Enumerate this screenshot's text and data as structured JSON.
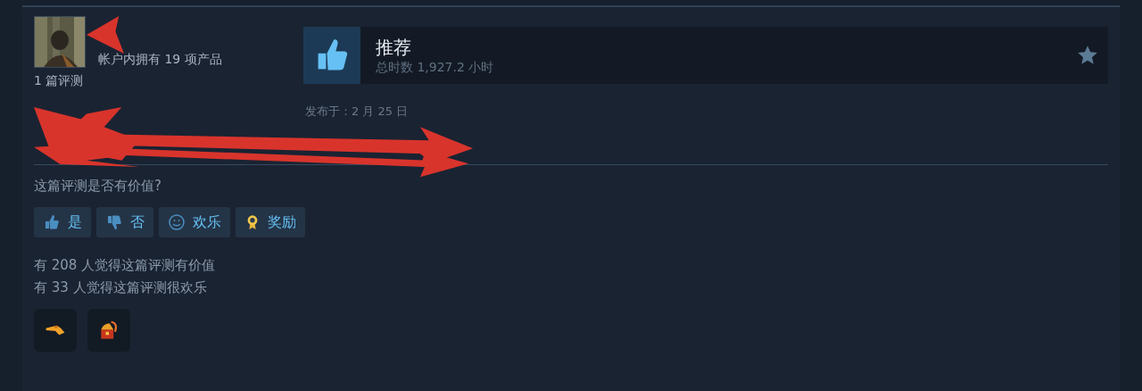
{
  "author": {
    "owned_products": "帐户内拥有 19 项产品",
    "review_count": "1 篇评测"
  },
  "verdict": {
    "title": "推荐",
    "hours": "总时数 1,927.2 小时",
    "recommended": true
  },
  "posted": "发布于：2 月 25 日",
  "helpful_prompt": "这篇评测是否有价值?",
  "vote_buttons": [
    {
      "kind": "yes",
      "label": "是"
    },
    {
      "kind": "no",
      "label": "否"
    },
    {
      "kind": "funny",
      "label": "欢乐"
    },
    {
      "kind": "award",
      "label": "奖励"
    }
  ],
  "stats": [
    "有 208 人觉得这篇评测有价值",
    "有 33 人觉得这篇评测很欢乐"
  ],
  "awards": [
    {
      "kind": "pointer"
    },
    {
      "kind": "chest"
    }
  ]
}
